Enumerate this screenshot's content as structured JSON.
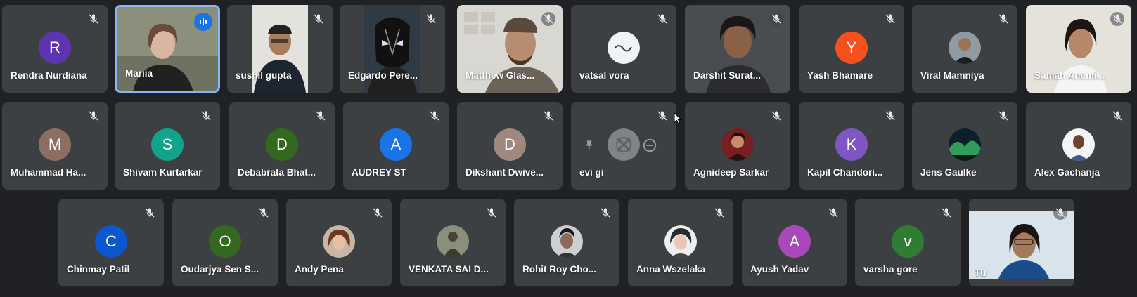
{
  "participants": [
    {
      "name": "Rendra Nurdiana",
      "initial": "R",
      "color": "#5e35b1"
    },
    {
      "name": "Mariia",
      "speaking": true
    },
    {
      "name": "sushil gupta"
    },
    {
      "name": "Edgardo Pere..."
    },
    {
      "name": "Matthew Glas..."
    },
    {
      "name": "vatsal vora"
    },
    {
      "name": "Darshit Surat..."
    },
    {
      "name": "Yash Bhamare",
      "initial": "Y",
      "color": "#f4511e"
    },
    {
      "name": "Viral Mamniya"
    },
    {
      "name": "Samah Anemi..."
    },
    {
      "name": "Muhammad Ha...",
      "initial": "M",
      "color": "#8d6e63"
    },
    {
      "name": "Shivam Kurtarkar",
      "initial": "S",
      "color": "#12a48a"
    },
    {
      "name": "Debabrata Bhat...",
      "initial": "D",
      "color": "#33691e"
    },
    {
      "name": "AUDREY ST",
      "initial": "A",
      "color": "#1a73e8"
    },
    {
      "name": "Dikshant Dwive...",
      "initial": "D",
      "color": "#a1887f"
    },
    {
      "name": "evi gi",
      "hovered": true
    },
    {
      "name": "Agnideep Sarkar"
    },
    {
      "name": "Kapil Chandori...",
      "initial": "K",
      "color": "#7e57c2"
    },
    {
      "name": "Jens Gaulke"
    },
    {
      "name": "Alex Gachanja"
    },
    {
      "name": "Chinmay Patil",
      "initial": "C",
      "color": "#0b57d0"
    },
    {
      "name": "Oudarjya Sen S...",
      "initial": "O",
      "color": "#33691e"
    },
    {
      "name": "Andy Pena"
    },
    {
      "name": "VENKATA SAI D..."
    },
    {
      "name": "Rohit Roy Cho..."
    },
    {
      "name": "Anna Wszelaka"
    },
    {
      "name": "Ayush Yadav",
      "initial": "A",
      "color": "#ab47bc"
    },
    {
      "name": "varsha gore",
      "initial": "v",
      "color": "#2e7d32"
    },
    {
      "name": "Tú",
      "self": true
    }
  ],
  "icons": {
    "muted": "mic-off-icon",
    "speaking": "audio-level-icon",
    "pin": "pin-icon",
    "remove": "remove-icon",
    "cursor": "mouse-cursor-icon"
  }
}
